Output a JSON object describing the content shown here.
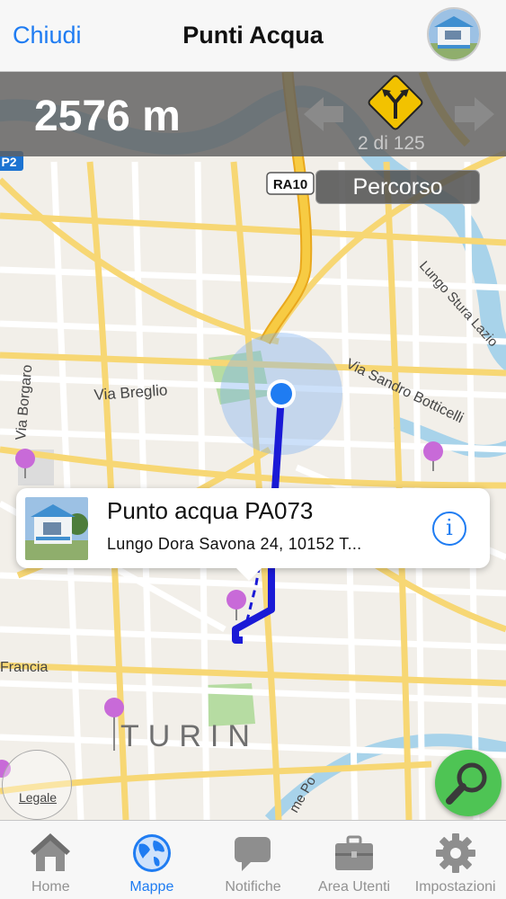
{
  "nav": {
    "close_label": "Chiudi",
    "title": "Punti Acqua",
    "avatar_icon": "kiosk-photo"
  },
  "directions": {
    "distance": "2576 m",
    "step_counter": "2 di 125",
    "turn_icon": "fork-road-sign-icon",
    "route_button": "Percorso"
  },
  "map": {
    "labels": {
      "via_breglio": "Via Breglio",
      "via_borgaro": "Via Borgaro",
      "via_sandro_botticelli": "Via Sandro Botticelli",
      "lungo_stura_lazio": "Lungo Stura Lazio",
      "francia": "Francia",
      "turin": "TURIN",
      "lungo_po": "me Po",
      "ra10": "RA10",
      "p2": "P2"
    },
    "legal_label": "Legale",
    "colors": {
      "route": "#1a1ad6",
      "user_location": "#1f7cf2",
      "pin": "#c86ad8",
      "highway": "#f5c33b",
      "water": "#a8d3ea",
      "park": "#b6dca2"
    }
  },
  "callout": {
    "title": "Punto acqua PA073",
    "subtitle": "Lungo Dora Savona 24, 10152 T...",
    "info_icon": "info-icon"
  },
  "tabs": [
    {
      "label": "Home",
      "icon": "house-icon",
      "active": false
    },
    {
      "label": "Mappe",
      "icon": "globe-icon",
      "active": true
    },
    {
      "label": "Notifiche",
      "icon": "speech-bubble-icon",
      "active": false
    },
    {
      "label": "Area Utenti",
      "icon": "briefcase-icon",
      "active": false
    },
    {
      "label": "Impostazioni",
      "icon": "gear-icon",
      "active": false
    }
  ]
}
